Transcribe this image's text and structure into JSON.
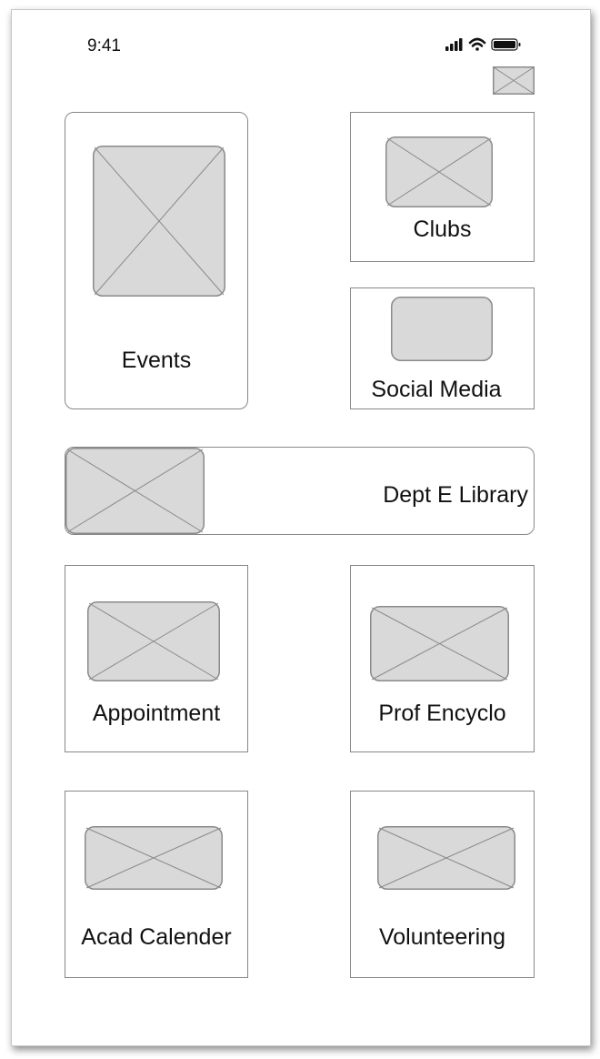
{
  "status_bar": {
    "time": "9:41",
    "signal_icon": "signal-bars-icon",
    "wifi_icon": "wifi-icon",
    "battery_icon": "battery-icon"
  },
  "header": {
    "corner_image": "image-placeholder-icon"
  },
  "tiles": {
    "events": "Events",
    "clubs": "Clubs",
    "social_media": "Social Media",
    "dept_library": "Dept E Library",
    "appointment": "Appointment",
    "prof_encyclo": "Prof Encyclo",
    "acad_calender": "Acad Calender",
    "volunteering": "Volunteering"
  },
  "colors": {
    "placeholder_fill": "#d9d9d9",
    "placeholder_stroke": "#8a8a8a",
    "border": "#888888"
  }
}
